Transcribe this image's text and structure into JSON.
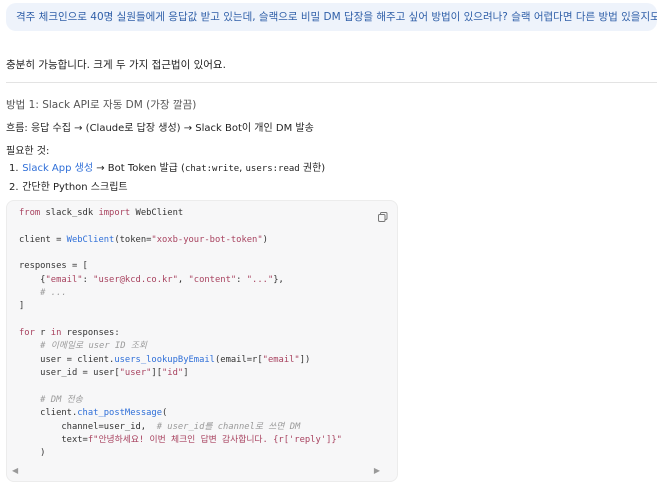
{
  "user_message": {
    "text": "격주 체크인으로 40명 실원들에게 응답값 받고 있는데, 슬랙으로 비밀 DM 답장을 해주고 싶어 방법이 있으려나? 슬랙 어렵다면 다른 방법 있을지도"
  },
  "answer": {
    "intro": "충분히 가능합니다. 크게 두 가지 접근법이 있어요.",
    "method1_heading": "방법 1: Slack API로 자동 DM (가장 깔끔)",
    "flow": "흐름: 응답 수집 → (Claude로 답장 생성) → Slack Bot이 개인 DM 발송",
    "needs_label": "필요한 것:",
    "steps": [
      {
        "num": "1.",
        "link": "Slack App 생성",
        "rest": " → Bot Token 발급 (",
        "code1": "chat:write",
        "sep": ", ",
        "code2": "users:read",
        "tail": " 권한)"
      },
      {
        "num": "2.",
        "text": "간단한 Python 스크립트"
      }
    ]
  },
  "code": {
    "l1": {
      "kw": "from",
      "t1": " slack_sdk ",
      "kw2": "import",
      "t2": " WebClient"
    },
    "l3": {
      "t1": "client = ",
      "fn": "WebClient",
      "t2": "(token=",
      "str": "\"xoxb-your-bot-token\"",
      "t3": ")"
    },
    "l5": "responses = [",
    "l6": {
      "t1": "    {",
      "s1": "\"email\"",
      "t2": ": ",
      "s2": "\"user@kcd.co.kr\"",
      "t3": ", ",
      "s3": "\"content\"",
      "t4": ": ",
      "s4": "\"...\"",
      "t5": "},"
    },
    "l7": "    # ...",
    "l8": "]",
    "l10": {
      "kw": "for",
      "t1": " r ",
      "kw2": "in",
      "t2": " responses:"
    },
    "l11": "    # 이메일로 user ID 조회",
    "l12": {
      "t1": "    user = client.",
      "fn": "users_lookupByEmail",
      "t2": "(email=r[",
      "str": "\"email\"",
      "t3": "])"
    },
    "l13": {
      "t1": "    user_id = user[",
      "s1": "\"user\"",
      "t2": "][",
      "s2": "\"id\"",
      "t3": "]"
    },
    "l15": "    # DM 전송",
    "l16": {
      "t1": "    client.",
      "fn": "chat_postMessage",
      "t2": "("
    },
    "l17": {
      "t1": "        channel=user_id,  ",
      "cm": "# user_id를 channel로 쓰면 DM"
    },
    "l18": {
      "t1": "        text=",
      "s1": "f\"안녕하세요! 이번 체크인 답변 감사합니다. {r[",
      "s2": "'reply'",
      "s3": "]}\""
    },
    "l19": "    )"
  },
  "icons": {
    "copy": "copy-icon",
    "scroll_left": "◀",
    "scroll_right": "▶"
  },
  "colors": {
    "accent_link": "#2f6fd8",
    "user_bubble_bg": "#eef3fb",
    "code_keyword": "#a8425f"
  }
}
